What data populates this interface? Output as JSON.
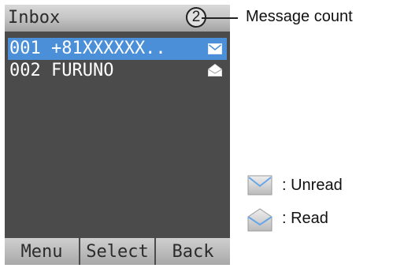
{
  "screen": {
    "title": "Inbox",
    "message_count": "2",
    "messages": [
      {
        "text": "001 +81XXXXXX..",
        "status": "unread",
        "icon": "envelope-closed-icon",
        "selected": true
      },
      {
        "text": "002 FURUNO",
        "status": "read",
        "icon": "envelope-open-icon",
        "selected": false
      }
    ],
    "softkeys": {
      "menu": "Menu",
      "select": "Select",
      "back": "Back"
    }
  },
  "annotations": {
    "message_count_label": "Message count",
    "legend": {
      "unread_label": ": Unread",
      "read_label": ": Read"
    }
  },
  "colors": {
    "screen_background": "#4b4b4b",
    "selection_highlight": "#4a8fd8",
    "titlebar": "#c4c4c4",
    "text": "#ffffff"
  }
}
